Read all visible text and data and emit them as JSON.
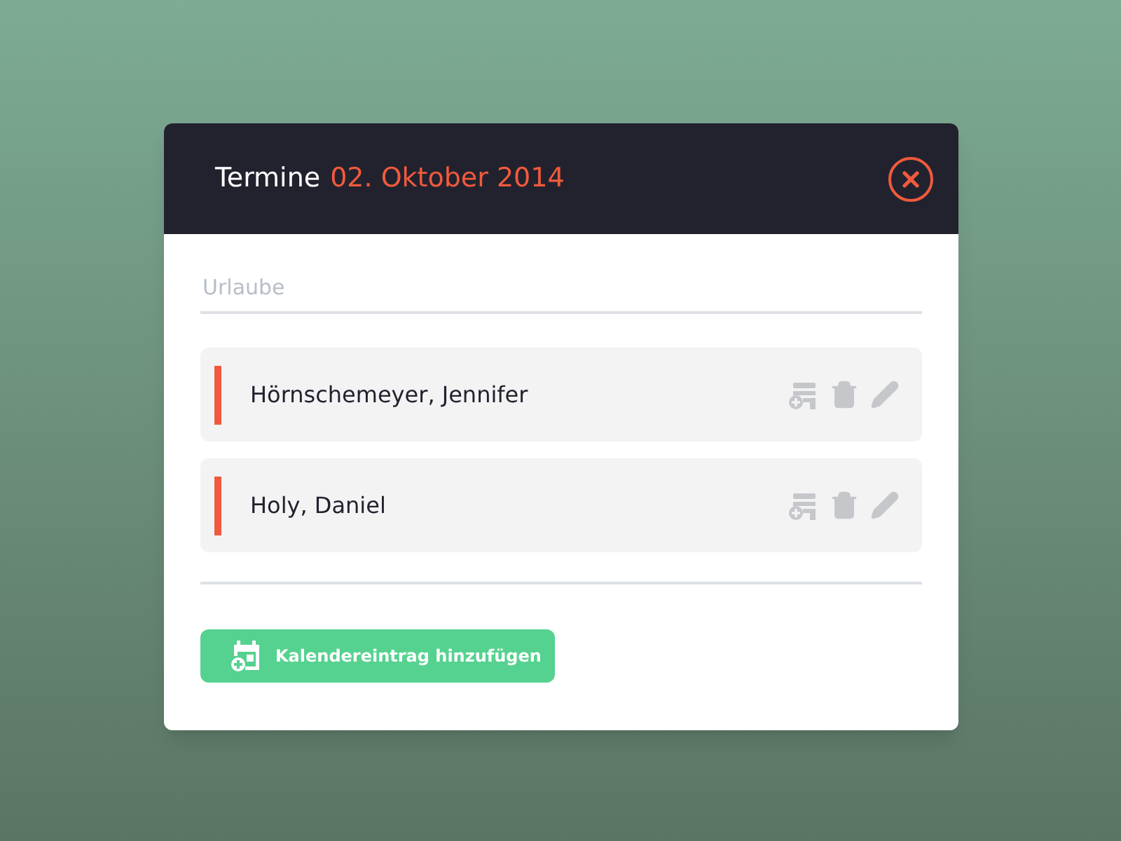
{
  "dialog": {
    "title": "Termine",
    "date": "02. Oktober 2014"
  },
  "section": {
    "heading": "Urlaube"
  },
  "entries": [
    {
      "name": "Hörnschemeyer, Jennifer",
      "color": "#f05a3c"
    },
    {
      "name": "Holy, Daniel",
      "color": "#f05a3c"
    }
  ],
  "add_button": {
    "label": "Kalendereintrag hinzufügen"
  }
}
